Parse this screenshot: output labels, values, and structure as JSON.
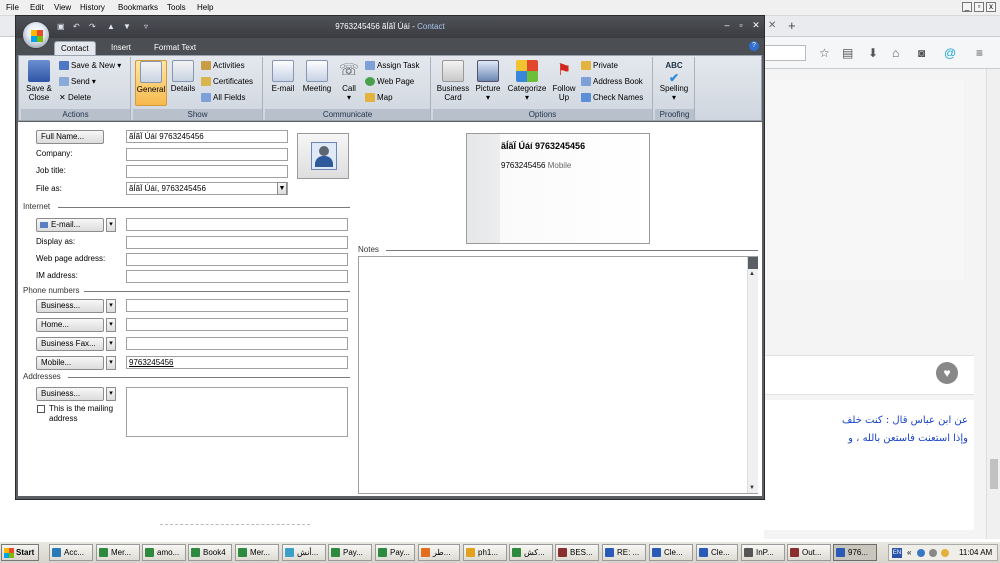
{
  "firefox": {
    "menu": [
      "File",
      "Edit",
      "View",
      "History",
      "Bookmarks",
      "Tools",
      "Help"
    ],
    "tab_new": "+",
    "arabic_line1": "عن ابن عباس قال : كنت خلف",
    "arabic_line2": "وإذا استعنت فاستعن بالله ، و"
  },
  "window": {
    "title_contact": "9763245456 ãÍãÏ Úáí",
    "title_sep": " - ",
    "title_app": "Contact",
    "controls": [
      "–",
      "▫",
      "✕"
    ]
  },
  "tabs": [
    "Contact",
    "Insert",
    "Format Text"
  ],
  "ribbon": {
    "actions": {
      "save_close": "Save & Close",
      "save_new": "Save & New",
      "send": "Send",
      "delete": "Delete",
      "label": "Actions"
    },
    "show": {
      "general": "General",
      "details": "Details",
      "activities": "Activities",
      "certificates": "Certificates",
      "all_fields": "All Fields",
      "label": "Show"
    },
    "communicate": {
      "email": "E-mail",
      "meeting": "Meeting",
      "call": "Call",
      "assign_task": "Assign Task",
      "web_page": "Web Page",
      "map": "Map",
      "label": "Communicate"
    },
    "options": {
      "business_card": "Business Card",
      "picture": "Picture",
      "categorize": "Categorize",
      "follow_up": "Follow Up",
      "private": "Private",
      "address_book": "Address Book",
      "check_names": "Check Names",
      "label": "Options"
    },
    "proofing": {
      "spelling": "Spelling",
      "abc": "ABC",
      "label": "Proofing"
    }
  },
  "form": {
    "full_name_btn": "Full Name...",
    "full_name": "ãÍãÏ Úáí 9763245456",
    "company_label": "Company:",
    "job_title_label": "Job title:",
    "file_as_label": "File as:",
    "file_as": "ãÍãÏ Úáí, 9763245456",
    "internet": "Internet",
    "email_btn": "E-mail...",
    "display_as_label": "Display as:",
    "web_page_label": "Web page address:",
    "im_label": "IM address:",
    "phone_numbers": "Phone numbers",
    "business_btn": "Business...",
    "home_btn": "Home...",
    "business_fax_btn": "Business Fax...",
    "mobile_btn": "Mobile...",
    "mobile": "9763245456",
    "addresses": "Addresses",
    "address_btn": "Business...",
    "mailing_address": "This is the mailing address",
    "notes_label": "Notes"
  },
  "card": {
    "name": "ãÍãÏ Úáí 9763245456",
    "phone": "9763245456",
    "phone_type": "Mobile"
  },
  "taskbar": {
    "start": "Start",
    "items": [
      "Acc...",
      "Mer...",
      "amo...",
      "Book4",
      "Mer...",
      "أنش...",
      "Pay...",
      "Pay...",
      "طر...",
      "ph1...",
      "كش...",
      "BES...",
      "RE: ...",
      "Cle...",
      "Cle...",
      "InP...",
      "Out...",
      "976..."
    ],
    "lang": "EN",
    "time": "11:04 AM"
  },
  "colors": {
    "accent": "#f7b94e",
    "window_frame": "#3a3c40",
    "link": "#1a44c8"
  }
}
